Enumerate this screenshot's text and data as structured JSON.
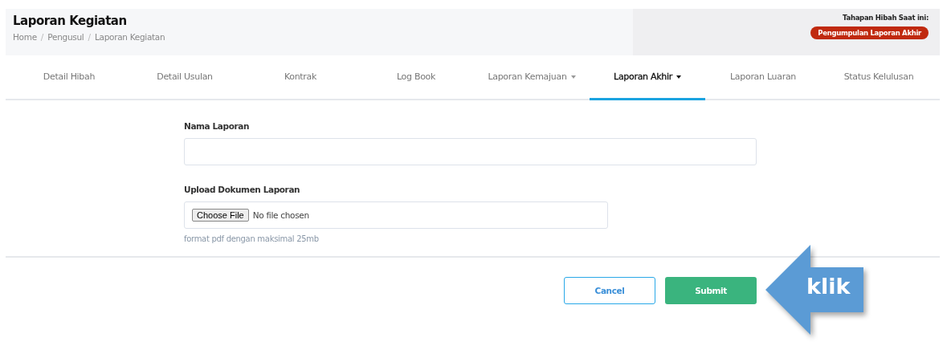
{
  "header": {
    "title": "Laporan Kegiatan",
    "breadcrumb": [
      {
        "label": "Home"
      },
      {
        "separator": "/",
        "label": "Pengusul"
      },
      {
        "separator": "/",
        "label": "Laporan Kegiatan"
      }
    ],
    "stage_label": "Tahapan Hibah Saat ini:",
    "stage_badge": "Pengumpulan Laporan Akhir"
  },
  "tabs": [
    {
      "label": "Detail Hibah",
      "selected": false,
      "dropdown": false
    },
    {
      "label": "Detail Usulan",
      "selected": false,
      "dropdown": false
    },
    {
      "label": "Kontrak",
      "selected": false,
      "dropdown": false
    },
    {
      "label": "Log Book",
      "selected": false,
      "dropdown": false
    },
    {
      "label": "Laporan Kemajuan",
      "selected": false,
      "dropdown": true
    },
    {
      "label": "Laporan Akhir",
      "selected": true,
      "dropdown": true
    },
    {
      "label": "Laporan Luaran",
      "selected": false,
      "dropdown": false
    },
    {
      "label": "Status Kelulusan",
      "selected": false,
      "dropdown": false
    }
  ],
  "form": {
    "fields": [
      {
        "kind": "text",
        "label": "Nama Laporan"
      },
      {
        "kind": "file",
        "label": "Upload Dokumen Laporan",
        "button": "Choose File",
        "value": "No file chosen",
        "hint": "format pdf dengan maksimal 25mb"
      }
    ],
    "buttons": [
      {
        "kind": "cancel",
        "label": "Cancel"
      },
      {
        "kind": "submit",
        "label": "Submit"
      }
    ]
  },
  "callout": {
    "label": "klik"
  }
}
